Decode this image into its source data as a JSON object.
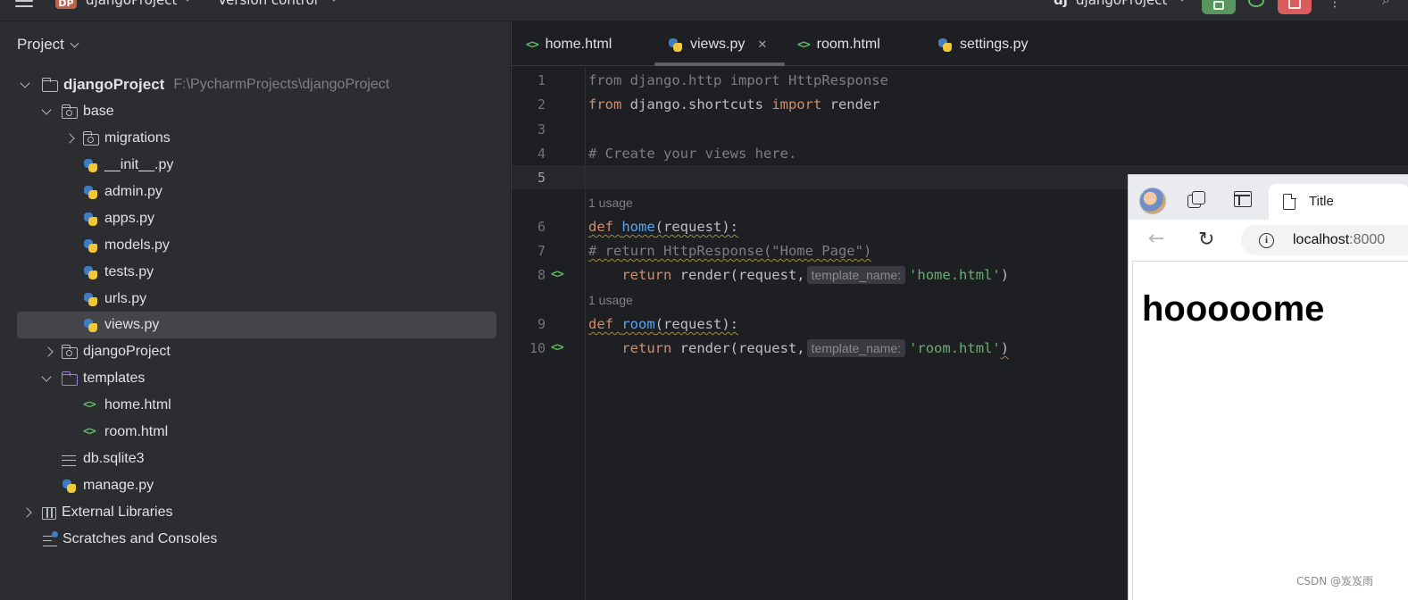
{
  "topbar": {
    "project_badge": "DP",
    "project_name": "djangoProject",
    "vcs_label": "Version control",
    "run_config": "djangoProject"
  },
  "project_panel": {
    "title": "Project",
    "tree": [
      {
        "name": "djangoProject",
        "path": "F:\\PycharmProjects\\djangoProject"
      },
      {
        "name": "base"
      },
      {
        "name": "migrations"
      },
      {
        "name": "__init__.py"
      },
      {
        "name": "admin.py"
      },
      {
        "name": "apps.py"
      },
      {
        "name": "models.py"
      },
      {
        "name": "tests.py"
      },
      {
        "name": "urls.py"
      },
      {
        "name": "views.py"
      },
      {
        "name": "djangoProject"
      },
      {
        "name": "templates"
      },
      {
        "name": "home.html"
      },
      {
        "name": "room.html"
      },
      {
        "name": "db.sqlite3"
      },
      {
        "name": "manage.py"
      },
      {
        "name": "External Libraries"
      },
      {
        "name": "Scratches and Consoles"
      }
    ]
  },
  "editor": {
    "tabs": [
      {
        "label": "home.html"
      },
      {
        "label": "views.py",
        "active": true
      },
      {
        "label": "room.html"
      },
      {
        "label": "settings.py"
      }
    ],
    "line_numbers": [
      "1",
      "2",
      "3",
      "4",
      "5",
      "6",
      "7",
      "8",
      "9",
      "10"
    ],
    "current_line": "5",
    "usage_hint": "1 usage",
    "inlay_hint": "template_name:",
    "code": {
      "line1": {
        "kw1": "from",
        "mod": " django.http ",
        "kw2": "import",
        "name": " HttpResponse"
      },
      "line2": {
        "kw1": "from",
        "mod": " django.shortcuts ",
        "kw2": "import",
        "name": " render"
      },
      "line4": "# Create your views here.",
      "line6": {
        "kw": "def",
        "fn": "home",
        "rest": "(request):"
      },
      "line7": "# return HttpResponse(\"Home Page\")",
      "line8": {
        "kw": "return",
        "call": " render(request,",
        "arg": "'home.html'",
        "end": ")"
      },
      "line9": {
        "kw": "def",
        "fn": "room",
        "rest": "(request):"
      },
      "line10": {
        "kw": "return",
        "call": " render(request,",
        "arg": "'room.html'",
        "end": ")"
      }
    }
  },
  "browser": {
    "tab_title": "Title",
    "url_host": "localhost",
    "url_port": ":8000",
    "heading": "hooooome"
  },
  "watermark": "CSDN @岌岌雨"
}
